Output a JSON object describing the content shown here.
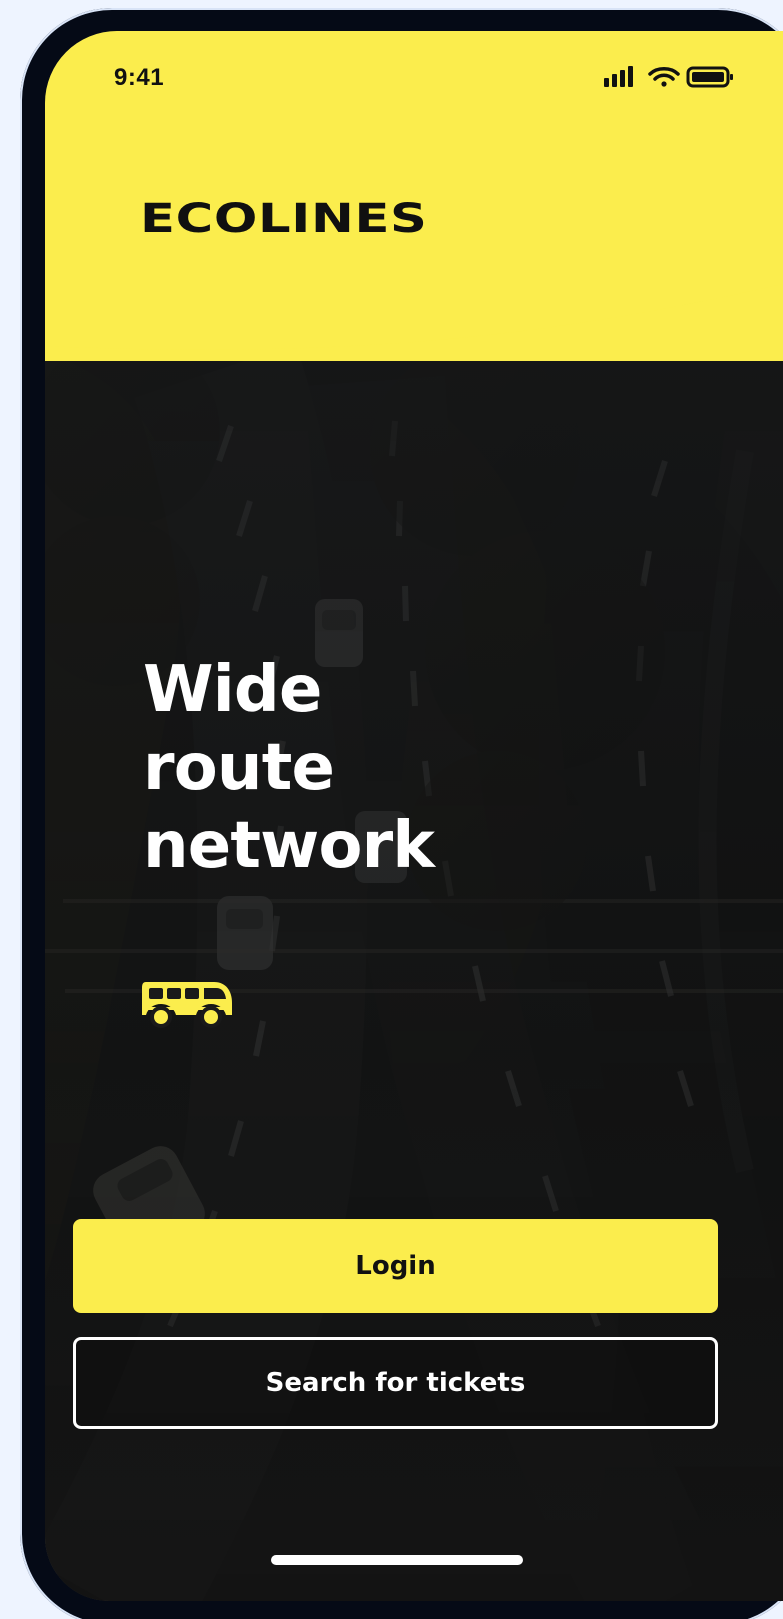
{
  "status_bar": {
    "time": "9:41"
  },
  "brand": {
    "logo_text": "ECOLINES"
  },
  "hero": {
    "headline_line_1": "Wide",
    "headline_line_2": "route",
    "headline_line_3": "network"
  },
  "buttons": {
    "login_label": "Login",
    "search_label": "Search for tickets"
  },
  "colors": {
    "accent_yellow": "#fbed4d",
    "text_dark": "#111111",
    "white": "#ffffff",
    "frame_dark": "#050a16"
  },
  "icons": {
    "status": [
      "cellular-signal-icon",
      "wifi-icon",
      "battery-icon"
    ],
    "hero": "bus-icon"
  }
}
